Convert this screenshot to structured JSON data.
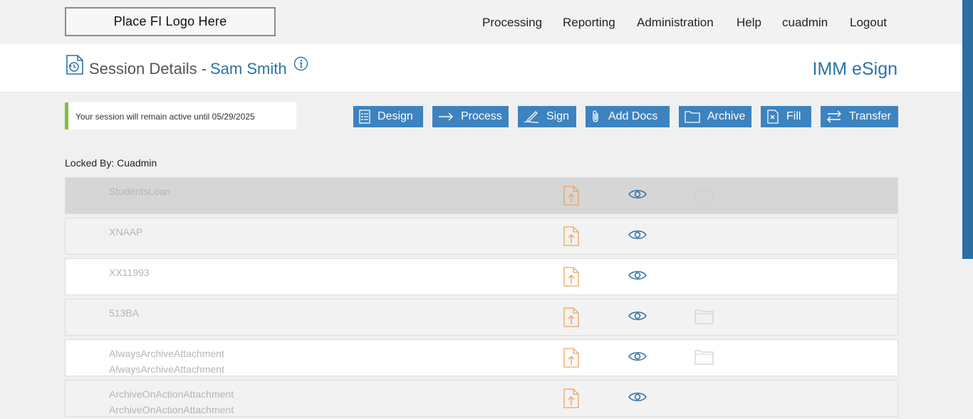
{
  "logo": {
    "text": "Place FI Logo Here"
  },
  "nav": {
    "items": [
      {
        "label": "Processing"
      },
      {
        "label": "Reporting"
      },
      {
        "label": "Administration"
      },
      {
        "label": "Help"
      },
      {
        "label": "cuadmin"
      },
      {
        "label": "Logout"
      }
    ]
  },
  "header": {
    "title": "Session Details -",
    "customer_name": "Sam Smith",
    "brand": "IMM eSign",
    "icons": {
      "title": "session-history-icon",
      "info": "info-icon"
    }
  },
  "notice": {
    "text": "Your session will remain active until 05/29/2025",
    "accent_color": "#7cc04b"
  },
  "actions": {
    "design": {
      "label": "Design",
      "icon": "list-icon"
    },
    "process": {
      "label": "Process",
      "icon": "arrow-right-icon"
    },
    "sign": {
      "label": "Sign",
      "icon": "pen-icon"
    },
    "add_docs": {
      "label": "Add Docs",
      "icon": "paperclip-icon"
    },
    "archive": {
      "label": "Archive",
      "icon": "folder-icon"
    },
    "fill": {
      "label": "Fill",
      "icon": "document-x-icon"
    },
    "transfer": {
      "label": "Transfer",
      "icon": "transfer-arrows-icon"
    },
    "button_color": "#3d83bf"
  },
  "locked_by": "Locked By: Cuadmin",
  "colors": {
    "brand_blue": "#2b73a5",
    "upload_orange": "#f0a35a",
    "eye_blue": "#2b6fa6",
    "scroll_thumb": "#2d6fa3"
  },
  "documents": [
    {
      "line1": "StudentsLoan",
      "line2": "",
      "has_folder": true,
      "selected": true
    },
    {
      "line1": "XNAAP",
      "line2": "",
      "has_folder": false,
      "selected": false
    },
    {
      "line1": "XX11993",
      "line2": "",
      "has_folder": false,
      "selected": false
    },
    {
      "line1": "513BA",
      "line2": "",
      "has_folder": true,
      "selected": false
    },
    {
      "line1": "AlwaysArchiveAttachment",
      "line2": "AlwaysArchiveAttachment",
      "has_folder": true,
      "selected": false
    },
    {
      "line1": "ArchiveOnActionAttachment",
      "line2": "ArchiveOnActionAttachment",
      "has_folder": false,
      "selected": false
    }
  ]
}
